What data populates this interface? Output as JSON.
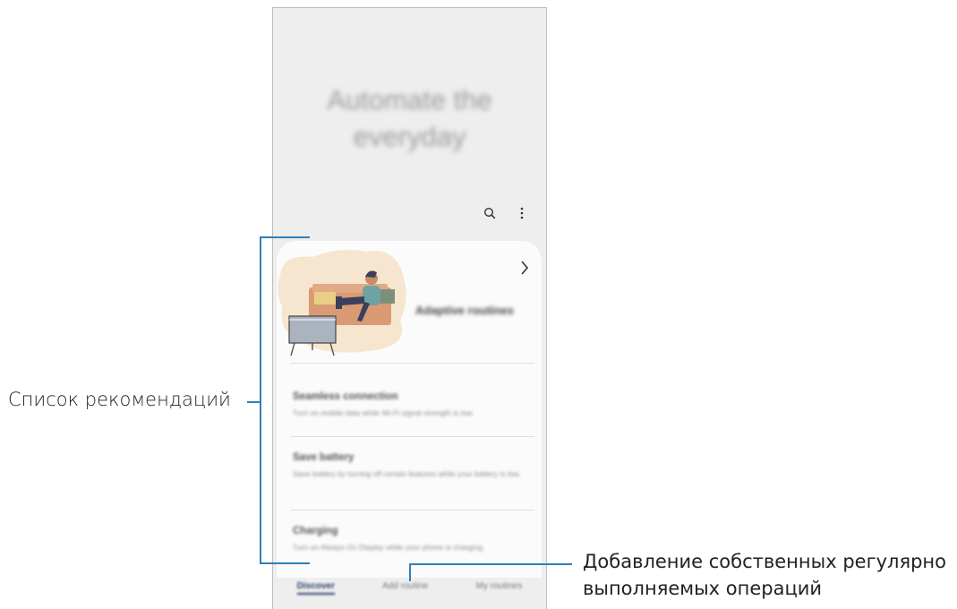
{
  "hero": {
    "line1": "Automate the",
    "line2": "everyday"
  },
  "toolbar": {
    "search_icon": "search-icon",
    "more_icon": "more-options-icon"
  },
  "card": {
    "title": "Adaptive routines",
    "items": [
      {
        "title": "Seamless connection",
        "description": "Turn on mobile data while Wi-Fi signal strength is low."
      },
      {
        "title": "Save battery",
        "description": "Save battery by turning off certain features while your battery is low."
      },
      {
        "title": "Charging",
        "description": "Turn on Always On Display while your phone is charging."
      }
    ]
  },
  "bottom_nav": {
    "discover": "Discover",
    "add_routine": "Add routine",
    "my_routines": "My routines"
  },
  "callouts": {
    "recommendations": "Список рекомендаций",
    "add_own_line1": "Добавление собственных регулярно",
    "add_own_line2": "выполняемых операций"
  },
  "colors": {
    "callout": "#2f7fb6",
    "nav_active": "#2c3e6b",
    "illustration": "#f6e6cf"
  }
}
